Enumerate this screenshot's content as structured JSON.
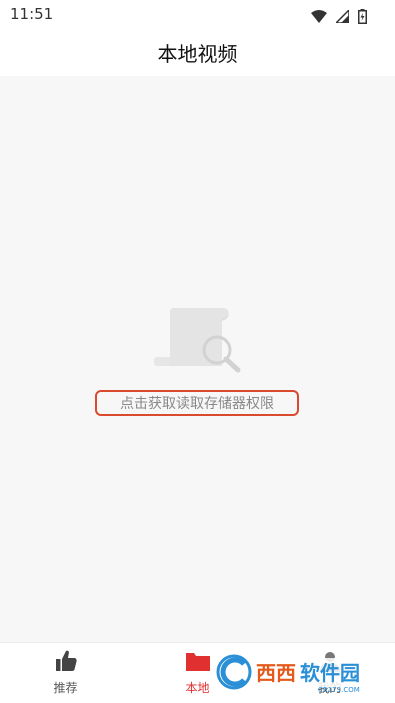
{
  "status_bar": {
    "time": "11:51",
    "icons": [
      "wifi-icon",
      "signal-icon",
      "battery-charging-icon"
    ]
  },
  "header": {
    "title": "本地视频"
  },
  "main": {
    "empty_state": {
      "icon": "document-search-icon",
      "action_label": "点击获取读取存储器权限"
    }
  },
  "bottom_nav": {
    "items": [
      {
        "label": "推荐",
        "icon": "thumbs-up-icon",
        "active": false
      },
      {
        "label": "本地",
        "icon": "folder-icon",
        "active": true
      },
      {
        "label": "我的",
        "icon": "person-icon",
        "active": false
      }
    ]
  },
  "watermark": {
    "text": "西西软件园",
    "subtext": "CR173.COM"
  },
  "colors": {
    "accent": "#e0302f",
    "highlight_border": "#d94a2f",
    "content_bg": "#f7f7f7"
  }
}
